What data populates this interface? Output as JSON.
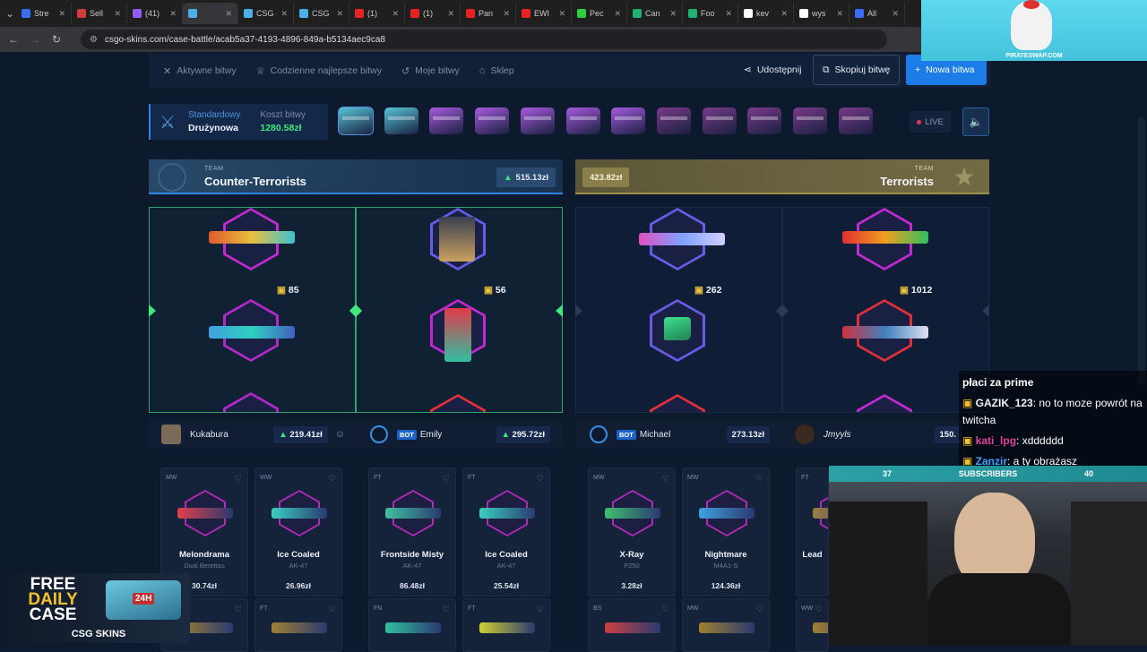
{
  "browser": {
    "tabs": [
      {
        "title": "Stre",
        "color": "#3b6cf5"
      },
      {
        "title": "Sell",
        "color": "#d23b3b"
      },
      {
        "title": "(41)",
        "color": "#8f5cf5"
      },
      {
        "title": "",
        "color": "#4bb0e6",
        "active": true
      },
      {
        "title": "CSG",
        "color": "#4bb0e6"
      },
      {
        "title": "CSG",
        "color": "#4bb0e6"
      },
      {
        "title": "(1)",
        "color": "#e62222"
      },
      {
        "title": "(1)",
        "color": "#e62222"
      },
      {
        "title": "Pan",
        "color": "#e62222"
      },
      {
        "title": "EWI",
        "color": "#e62222"
      },
      {
        "title": "Pec",
        "color": "#2ecc40"
      },
      {
        "title": "Can",
        "color": "#20b070"
      },
      {
        "title": "Foo",
        "color": "#20b070"
      },
      {
        "title": "kev",
        "color": "#ffffff"
      },
      {
        "title": "wys",
        "color": "#ffffff"
      },
      {
        "title": "All",
        "color": "#3b6cf5"
      }
    ],
    "url": "csgo-skins.com/case-battle/acab5a37-4193-4896-849a-b5134aec9ca8"
  },
  "nav": {
    "active_battles": "Aktywne bitwy",
    "daily_best": "Codzienne najlepsze bitwy",
    "my_battles": "Moje bitwy",
    "shop": "Sklep",
    "share": "Udostępnij",
    "copy": "Skopiuj bitwę",
    "new_battle": "Nowa bitwa"
  },
  "battle": {
    "mode_label": "Standardowy",
    "mode_value": "Drużynowa",
    "cost_label": "Koszt bitwy",
    "cost_value": "1280.58zł",
    "live": "LIVE",
    "case_colors": [
      "#58c6d8",
      "#58c6d8",
      "#a85ae0",
      "#a85ae0",
      "#a85ae0",
      "#a85ae0",
      "#a85ae0",
      "#7a3a8a",
      "#7a3a8a",
      "#7a3a8a",
      "#7a3a8a",
      "#7a3a8a"
    ]
  },
  "teams": {
    "ct": {
      "small": "TEAM",
      "name": "Counter-Terrorists",
      "total": "515.13zł"
    },
    "t": {
      "small": "TEAM",
      "name": "Terrorists",
      "total": "423.82zł"
    }
  },
  "columns": [
    {
      "coins": "85"
    },
    {
      "coins": "56"
    },
    {
      "coins": "262"
    },
    {
      "coins": "1012"
    }
  ],
  "players": [
    {
      "name": "Kukabura",
      "value": "219.41zł"
    },
    {
      "name": "Emily",
      "bot": "BOT",
      "value": "295.72zł"
    },
    {
      "name": "Michael",
      "bot": "BOT",
      "value": "273.13zł"
    },
    {
      "name": "Jmyyls",
      "value": "150."
    }
  ],
  "items": [
    {
      "cond": "MW",
      "name": "Melondrama",
      "sub": "Dual Berettas",
      "price": "30.74zł",
      "color": "#e0404a"
    },
    {
      "cond": "WW",
      "name": "Ice Coaled",
      "sub": "AK-47",
      "price": "26.96zł",
      "color": "#3ad0c0"
    },
    {
      "cond": "FT",
      "name": "Frontside Misty",
      "sub": "AK-47",
      "price": "86.48zł",
      "color": "#40c0a0"
    },
    {
      "cond": "FT",
      "name": "Ice Coaled",
      "sub": "AK-47",
      "price": "25.54zł",
      "color": "#3ad0c0"
    },
    {
      "cond": "MW",
      "name": "X-Ray",
      "sub": "P250",
      "price": "3.28zł",
      "color": "#3fc070"
    },
    {
      "cond": "MW",
      "name": "Nightmare",
      "sub": "M4A1-S",
      "price": "124.36zł",
      "color": "#40a0e0"
    },
    {
      "cond": "FT",
      "name": "Lead",
      "sub": "",
      "price": "",
      "color": "#a08040"
    }
  ],
  "items_row2": [
    {
      "cond": "",
      "color": "#a08030"
    },
    {
      "cond": "FT",
      "color": "#a08030"
    },
    {
      "cond": "FN",
      "color": "#30c0a0"
    },
    {
      "cond": "FT",
      "color": "#d0d030"
    },
    {
      "cond": "BS",
      "color": "#d04040"
    },
    {
      "cond": "MW",
      "color": "#a08030"
    },
    {
      "cond": "WW",
      "color": "#a08030"
    }
  ],
  "chat": [
    {
      "user": "",
      "msg": "płaci za prime"
    },
    {
      "user": "GAZIK_123",
      "msg": ": no to moze powrót na twitcha",
      "color": "#f0f3f9"
    },
    {
      "user": "kati_lpg",
      "msg": ": xdddddd",
      "color": "#e0409a"
    },
    {
      "user": "Zanzir",
      "msg": ": a ty obrażasz",
      "color": "#40a0ff"
    }
  ],
  "webcam": {
    "left": "37",
    "title": "SUBSCRIBERS",
    "right": "40"
  },
  "pirate": {
    "text": "PIRATESWAP.COM"
  },
  "promo": {
    "line1": "FREE",
    "line2": "DAILY",
    "line3": "CASE",
    "brand": "CSG SKINS",
    "badge": "24H"
  }
}
